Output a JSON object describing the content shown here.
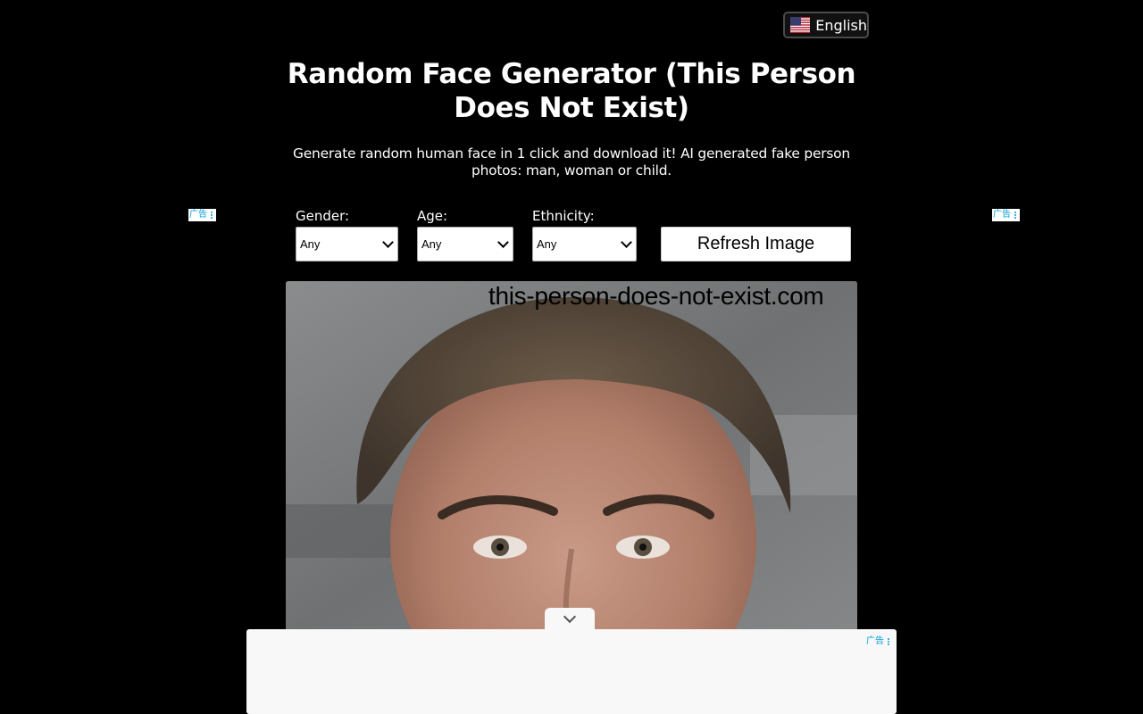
{
  "language": {
    "label": "English",
    "flag_icon": "us-flag-icon"
  },
  "header": {
    "title": "Random Face Generator (This Person Does Not Exist)",
    "subtitle": "Generate random human face in 1 click and download it! AI generated fake person photos: man, woman or child."
  },
  "ads": {
    "label": "广告"
  },
  "filters": {
    "gender": {
      "label": "Gender:",
      "value": "Any"
    },
    "age": {
      "label": "Age:",
      "value": "Any"
    },
    "ethnicity": {
      "label": "Ethnicity:",
      "value": "Any"
    },
    "refresh_label": "Refresh Image"
  },
  "image": {
    "watermark": "this-person-does-not-exist.com"
  },
  "colors": {
    "background": "#000000",
    "ad_accent": "#00a0d6"
  }
}
